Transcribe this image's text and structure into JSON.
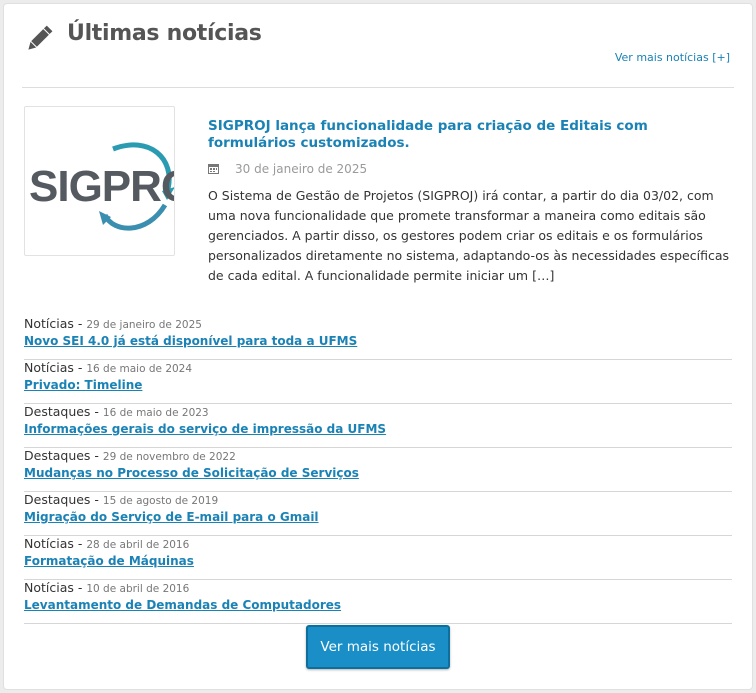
{
  "header": {
    "title": "Últimas notícias",
    "more_link": "Ver mais notícias [+]"
  },
  "featured": {
    "logo_text": "SIGPROJ",
    "title": "SIGPROJ lança funcionalidade para criação de Editais com formulários customizados.",
    "date": "30 de janeiro de 2025",
    "excerpt": "O Sistema de Gestão de Projetos (SIGPROJ) irá contar, a partir do dia 03/02, com uma nova funcionalidade que promete transformar a maneira como editais são gerenciados. A partir disso, os gestores podem criar os editais e os formulários personalizados diretamente no sistema, adaptando-os às necessidades específicas de cada edital. A funcionalidade permite iniciar um […]"
  },
  "news": [
    {
      "category": "Notícias",
      "date": "29 de janeiro de 2025",
      "title": "Novo SEI 4.0 já está disponível para toda a UFMS"
    },
    {
      "category": "Notícias",
      "date": "16 de maio de 2024",
      "title": "Privado: Timeline"
    },
    {
      "category": "Destaques",
      "date": "16 de maio de 2023",
      "title": "Informações gerais do serviço de impressão da UFMS"
    },
    {
      "category": "Destaques",
      "date": "29 de novembro de 2022",
      "title": "Mudanças no Processo de Solicitação de Serviços"
    },
    {
      "category": "Destaques",
      "date": "15 de agosto de 2019",
      "title": "Migração do Serviço de E-mail para o Gmail"
    },
    {
      "category": "Notícias",
      "date": "28 de abril de 2016",
      "title": "Formatação de Máquinas"
    },
    {
      "category": "Notícias",
      "date": "10 de abril de 2016",
      "title": "Levantamento de Demandas de Computadores"
    }
  ],
  "footer": {
    "button_label": "Ver mais notícias"
  },
  "colors": {
    "link": "#1a82b5",
    "button": "#1a8fc7",
    "logo_gray": "#555a60",
    "logo_teal": "#2a9bb0"
  }
}
